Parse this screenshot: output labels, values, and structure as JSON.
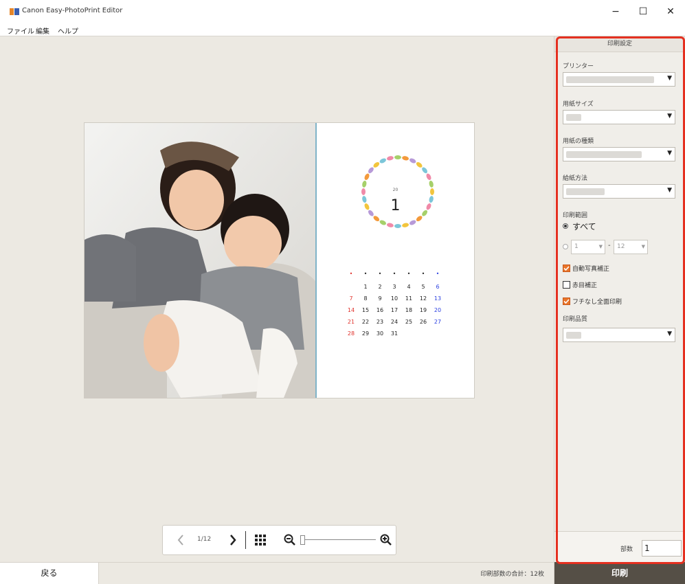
{
  "window": {
    "title": "Canon Easy-PhotoPrint Editor",
    "minimize": "−",
    "maximize": "☐",
    "close": "✕"
  },
  "menu": [
    "ファイル",
    "編集",
    "ヘルプ"
  ],
  "calendar": {
    "year": "20",
    "month": "1",
    "weekday_marks": [
      "•",
      "•",
      "•",
      "•",
      "•",
      "•",
      "•"
    ],
    "weeks": [
      [
        "",
        "1",
        "2",
        "3",
        "4",
        "5",
        "6"
      ],
      [
        "7",
        "8",
        "9",
        "10",
        "11",
        "12",
        "13"
      ],
      [
        "14",
        "15",
        "16",
        "17",
        "18",
        "19",
        "20"
      ],
      [
        "21",
        "22",
        "23",
        "24",
        "25",
        "26",
        "27"
      ],
      [
        "28",
        "29",
        "30",
        "31",
        "",
        "",
        ""
      ]
    ]
  },
  "toolbar": {
    "prev_icon": "chevron-left-icon",
    "page_indicator": "1/12",
    "next_icon": "chevron-right-icon",
    "grid_icon": "grid-icon",
    "zoom_out_icon": "zoom-out-icon",
    "zoom_in_icon": "zoom-in-icon",
    "zoom_level": 0.0
  },
  "bottom": {
    "back_label": "戻る",
    "total": "印刷部数の合計：12枚"
  },
  "panel": {
    "header": "印刷設定",
    "printer_label": "プリンター",
    "paper_size_label": "用紙サイズ",
    "media_type_label": "用紙の種類",
    "paper_source_label": "給紙方法",
    "range_label": "印刷範囲",
    "range_all": "すべて",
    "range_from": "1",
    "range_to": "12",
    "range_sep": "-",
    "auto_correct": "自動写真補正",
    "auto_correct_checked": true,
    "red_eye": "赤目補正",
    "red_eye_checked": false,
    "borderless": "フチなし全面印刷",
    "borderless_checked": true,
    "quality_label": "印刷品質",
    "copies_label": "部数",
    "copies_value": "1",
    "print_label": "印刷"
  },
  "colors": {
    "accent_orange": "#e9752a",
    "highlight_red": "#e53020",
    "print_button": "#554f46",
    "sunday_red": "#e0302a",
    "saturday_blue": "#2a3fe0"
  }
}
